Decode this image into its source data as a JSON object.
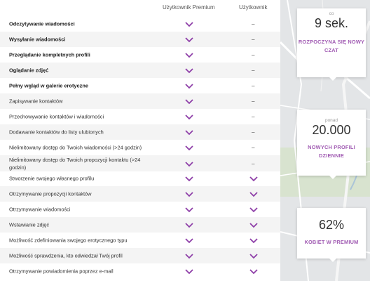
{
  "columns": {
    "premium": "Użytkownik Premium",
    "user": "Użytkownik"
  },
  "rows": [
    {
      "label": "Odczytywanie wiadomości",
      "bold": true,
      "premium": true,
      "user": false
    },
    {
      "label": "Wysyłanie wiadomości",
      "bold": true,
      "premium": true,
      "user": false
    },
    {
      "label": "Przeglądanie kompletnych profili",
      "bold": true,
      "premium": true,
      "user": false
    },
    {
      "label": "Oglądanie zdjęć",
      "bold": true,
      "premium": true,
      "user": false
    },
    {
      "label": "Pełny wgląd w galerie erotyczne",
      "bold": true,
      "premium": true,
      "user": false
    },
    {
      "label": "Zapisywanie kontaktów",
      "bold": false,
      "premium": true,
      "user": false
    },
    {
      "label": "Przechowywanie kontaktów i wiadomości",
      "bold": false,
      "premium": true,
      "user": false
    },
    {
      "label": "Dodawanie kontaktów do listy ulubionych",
      "bold": false,
      "premium": true,
      "user": false
    },
    {
      "label": "Nielimitowany dostęp do Twoich wiadomości (>24 godzin)",
      "bold": false,
      "premium": true,
      "user": false
    },
    {
      "label": "Nielimitowany dostęp do Twoich propozycji kontaktu (>24 godzin)",
      "bold": false,
      "premium": true,
      "user": false
    },
    {
      "label": "Stworzenie swojego własnego profilu",
      "bold": false,
      "premium": true,
      "user": true
    },
    {
      "label": "Otrzymywanie propozycji kontaktów",
      "bold": false,
      "premium": true,
      "user": true
    },
    {
      "label": "Otrzymywanie wiadomości",
      "bold": false,
      "premium": true,
      "user": true
    },
    {
      "label": "Wstawianie zdjęć",
      "bold": false,
      "premium": true,
      "user": true
    },
    {
      "label": "Możliwość zdefiniowania swojego erotycznego typu",
      "bold": false,
      "premium": true,
      "user": true
    },
    {
      "label": "Możliwość sprawdzenia, kto odwiedzał Twój profil",
      "bold": false,
      "premium": true,
      "user": true
    },
    {
      "label": "Otrzymywanie powiadomienia poprzez e-mail",
      "bold": false,
      "premium": true,
      "user": true
    }
  ],
  "dash_symbol": "–",
  "stats": [
    {
      "small": "co",
      "big": "9 sek.",
      "caption": "ROZPOCZYNA SIĘ NOWY CZAT"
    },
    {
      "small": "ponad",
      "big": "20.000",
      "caption": "NOWYCH PROFILI DZIENNIE"
    },
    {
      "small": "",
      "big": "62%",
      "caption": "KOBIET W PREMIUM"
    }
  ],
  "colors": {
    "check": "#8e3fa8",
    "caption": "#a15cb3"
  }
}
